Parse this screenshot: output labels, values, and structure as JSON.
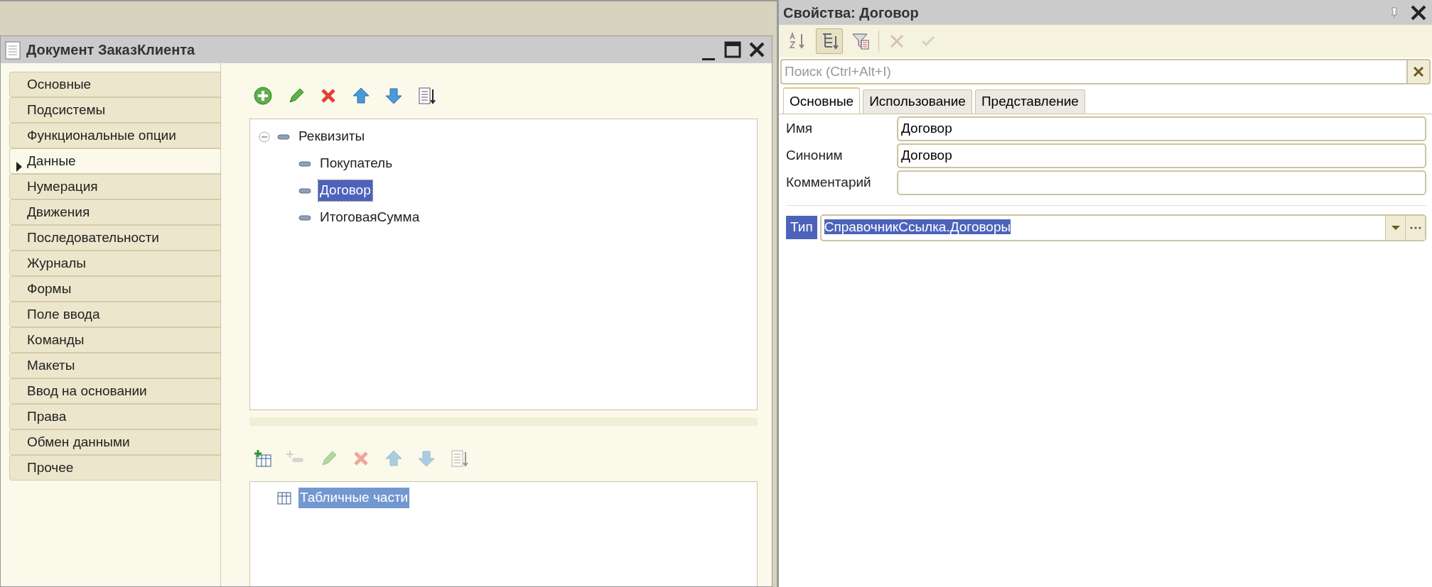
{
  "document_window": {
    "title": "Документ ЗаказКлиента",
    "sidebar": {
      "items": [
        {
          "label": "Основные",
          "selected": false
        },
        {
          "label": "Подсистемы",
          "selected": false
        },
        {
          "label": "Функциональные опции",
          "selected": false
        },
        {
          "label": "Данные",
          "selected": true
        },
        {
          "label": "Нумерация",
          "selected": false
        },
        {
          "label": "Движения",
          "selected": false
        },
        {
          "label": "Последовательности",
          "selected": false
        },
        {
          "label": "Журналы",
          "selected": false
        },
        {
          "label": "Формы",
          "selected": false
        },
        {
          "label": "Поле ввода",
          "selected": false
        },
        {
          "label": "Команды",
          "selected": false
        },
        {
          "label": "Макеты",
          "selected": false
        },
        {
          "label": "Ввод на основании",
          "selected": false
        },
        {
          "label": "Права",
          "selected": false
        },
        {
          "label": "Обмен данными",
          "selected": false
        },
        {
          "label": "Прочее",
          "selected": false
        }
      ]
    },
    "attributes_toolbar": [
      {
        "kind": "add",
        "disabled": false
      },
      {
        "kind": "edit",
        "disabled": false
      },
      {
        "kind": "delete",
        "disabled": false
      },
      {
        "kind": "up",
        "disabled": false
      },
      {
        "kind": "down",
        "disabled": false
      },
      {
        "kind": "sort",
        "disabled": false
      }
    ],
    "attributes_tree": {
      "label": "Реквизиты",
      "expanded": true,
      "children": [
        {
          "label": "Покупатель",
          "selected": false
        },
        {
          "label": "Договор",
          "selected": true
        },
        {
          "label": "ИтоговаяСумма",
          "selected": false
        }
      ]
    },
    "table_parts_toolbar": [
      {
        "kind": "add_table",
        "disabled": false
      },
      {
        "kind": "add_sub",
        "disabled": true
      },
      {
        "kind": "edit",
        "disabled": true
      },
      {
        "kind": "delete",
        "disabled": true
      },
      {
        "kind": "up",
        "disabled": true
      },
      {
        "kind": "down",
        "disabled": true
      },
      {
        "kind": "sort",
        "disabled": true
      }
    ],
    "table_parts_tree": [
      {
        "label": "Табличные части",
        "selected": true
      }
    ]
  },
  "properties_panel": {
    "title": "Свойства: Договор",
    "toolbar": [
      {
        "kind": "az",
        "disabled": false,
        "pressed": false
      },
      {
        "kind": "tree",
        "disabled": false,
        "pressed": true
      },
      {
        "kind": "filter",
        "disabled": false,
        "pressed": false
      },
      {
        "kind": "cancel",
        "disabled": true,
        "pressed": false
      },
      {
        "kind": "ok",
        "disabled": true,
        "pressed": false
      }
    ],
    "search": {
      "placeholder": "Поиск (Ctrl+Alt+I)"
    },
    "tabs": [
      {
        "label": "Основные",
        "selected": true
      },
      {
        "label": "Использование",
        "selected": false
      },
      {
        "label": "Представление",
        "selected": false
      }
    ],
    "fields": [
      {
        "label": "Имя",
        "value": "Договор"
      },
      {
        "label": "Синоним",
        "value": "Договор"
      },
      {
        "label": "Комментарий"
      }
    ],
    "type_field": {
      "label": "Тип",
      "value": "СправочникСсылка.Договоры",
      "selected": true
    }
  }
}
